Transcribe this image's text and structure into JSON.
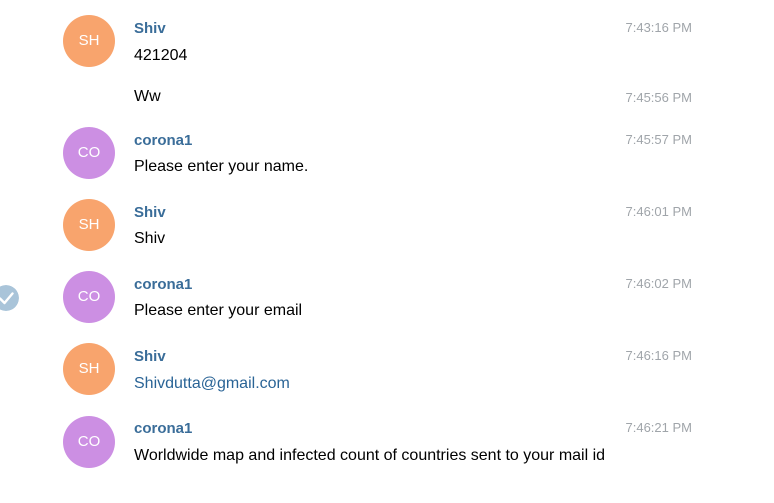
{
  "colors": {
    "avatar_sh": "#f8a46d",
    "avatar_co": "#cc8fe3",
    "sender": "#3a6d99",
    "timestamp": "#a0a5aa",
    "link": "#2a6496",
    "check_bg": "#a9c4d9"
  },
  "messages": [
    {
      "avatar": "SH",
      "sender": "Shiv",
      "text": "421204",
      "time": "7:43:16 PM"
    },
    {
      "text": "Ww",
      "time": "7:45:56 PM"
    },
    {
      "avatar": "CO",
      "sender": "corona1",
      "text": "Please enter your name.",
      "time": "7:45:57 PM"
    },
    {
      "avatar": "SH",
      "sender": "Shiv",
      "text": "Shiv",
      "time": "7:46:01 PM"
    },
    {
      "avatar": "CO",
      "sender": "corona1",
      "text": "Please enter your email",
      "time": "7:46:02 PM",
      "selected_icon": "checkmark-icon"
    },
    {
      "avatar": "SH",
      "sender": "Shiv",
      "text": "Shivdutta@gmail.com",
      "time": "7:46:16 PM"
    },
    {
      "avatar": "CO",
      "sender": "corona1",
      "text": "Worldwide map and infected count of countries sent to your mail id",
      "time": "7:46:21 PM"
    }
  ]
}
